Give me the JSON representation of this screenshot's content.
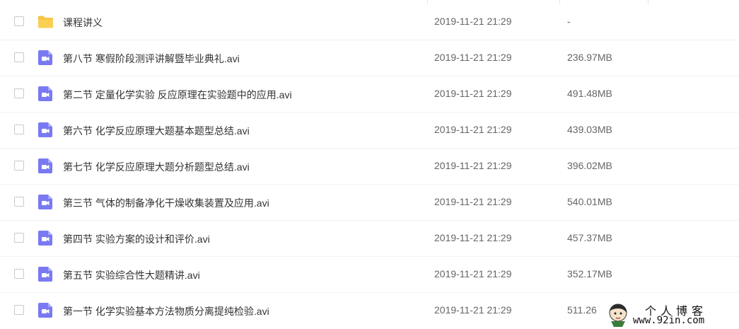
{
  "files": [
    {
      "name": "课程讲义",
      "date": "2019-11-21 21:29",
      "size": "-",
      "type": "folder-icon"
    },
    {
      "name": "第八节 寒假阶段测评讲解暨毕业典礼.avi",
      "date": "2019-11-21 21:29",
      "size": "236.97MB",
      "type": "video-icon"
    },
    {
      "name": "第二节 定量化学实验 反应原理在实验题中的应用.avi",
      "date": "2019-11-21 21:29",
      "size": "491.48MB",
      "type": "video-icon"
    },
    {
      "name": "第六节 化学反应原理大题基本题型总结.avi",
      "date": "2019-11-21 21:29",
      "size": "439.03MB",
      "type": "video-icon"
    },
    {
      "name": "第七节 化学反应原理大题分析题型总结.avi",
      "date": "2019-11-21 21:29",
      "size": "396.02MB",
      "type": "video-icon"
    },
    {
      "name": "第三节 气体的制备净化干燥收集装置及应用.avi",
      "date": "2019-11-21 21:29",
      "size": "540.01MB",
      "type": "video-icon"
    },
    {
      "name": "第四节 实验方案的设计和评价.avi",
      "date": "2019-11-21 21:29",
      "size": "457.37MB",
      "type": "video-icon"
    },
    {
      "name": "第五节 实验综合性大题精讲.avi",
      "date": "2019-11-21 21:29",
      "size": "352.17MB",
      "type": "video-icon"
    },
    {
      "name": "第一节 化学实验基本方法物质分离提纯检验.avi",
      "date": "2019-11-21 21:29",
      "size": "511.26",
      "type": "video-icon"
    }
  ],
  "watermark": {
    "title": "个人博客",
    "url": "www.92in.com"
  },
  "colors": {
    "folder": "#f7c344",
    "video": "#7a79f3",
    "text": "#333333",
    "meta": "#666666"
  }
}
